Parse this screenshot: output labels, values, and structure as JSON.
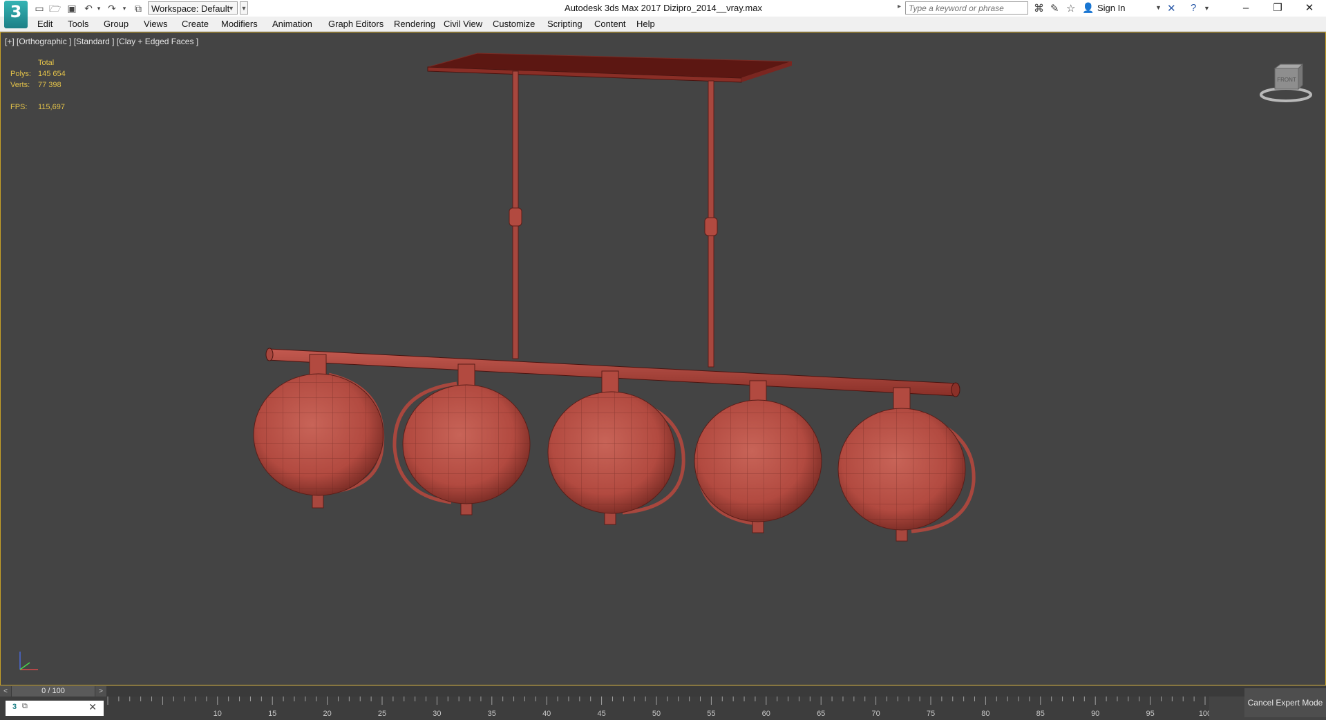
{
  "app": {
    "logo": "3",
    "window_title": "Autodesk 3ds Max 2017    Dizipro_2014__vray.max"
  },
  "quick_access": {
    "workspace_label": "Workspace: Default",
    "icons": [
      "new-file-icon",
      "open-file-icon",
      "save-icon",
      "undo-icon",
      "redo-icon",
      "project-folder-icon"
    ]
  },
  "search": {
    "placeholder": "Type a keyword or phrase"
  },
  "account": {
    "sign_in_label": "Sign In"
  },
  "window_controls": {
    "minimize": "–",
    "restore": "❐",
    "close": "✕"
  },
  "menu": {
    "items": [
      {
        "label": "Edit"
      },
      {
        "label": "Tools"
      },
      {
        "label": "Group"
      },
      {
        "label": "Views"
      },
      {
        "label": "Create"
      },
      {
        "label": "Modifiers"
      },
      {
        "label": "Animation"
      },
      {
        "label": "Graph Editors"
      },
      {
        "label": "Rendering"
      },
      {
        "label": "Civil View"
      },
      {
        "label": "Customize"
      },
      {
        "label": "Scripting"
      },
      {
        "label": "Content"
      },
      {
        "label": "Help"
      }
    ]
  },
  "viewport": {
    "label": "[+] [Orthographic ] [Standard ] [Clay + Edged Faces ]",
    "stats": {
      "header": "Total",
      "polys_label": "Polys:",
      "polys_value": "145 654",
      "verts_label": "Verts:",
      "verts_value": "77 398",
      "fps_label": "FPS:",
      "fps_value": "115,697"
    },
    "viewcube_label": "FRONT",
    "scene_color": "#b84a42"
  },
  "timeline": {
    "frame_display": "0 / 100",
    "prev": "<",
    "next": ">",
    "tick_labels": [
      "10",
      "15",
      "20",
      "25",
      "30",
      "35",
      "40",
      "45",
      "50",
      "55",
      "60",
      "65",
      "70",
      "75",
      "80",
      "85",
      "90",
      "95",
      "100"
    ]
  },
  "status": {
    "cancel_expert_label": "Cancel Expert Mode"
  }
}
